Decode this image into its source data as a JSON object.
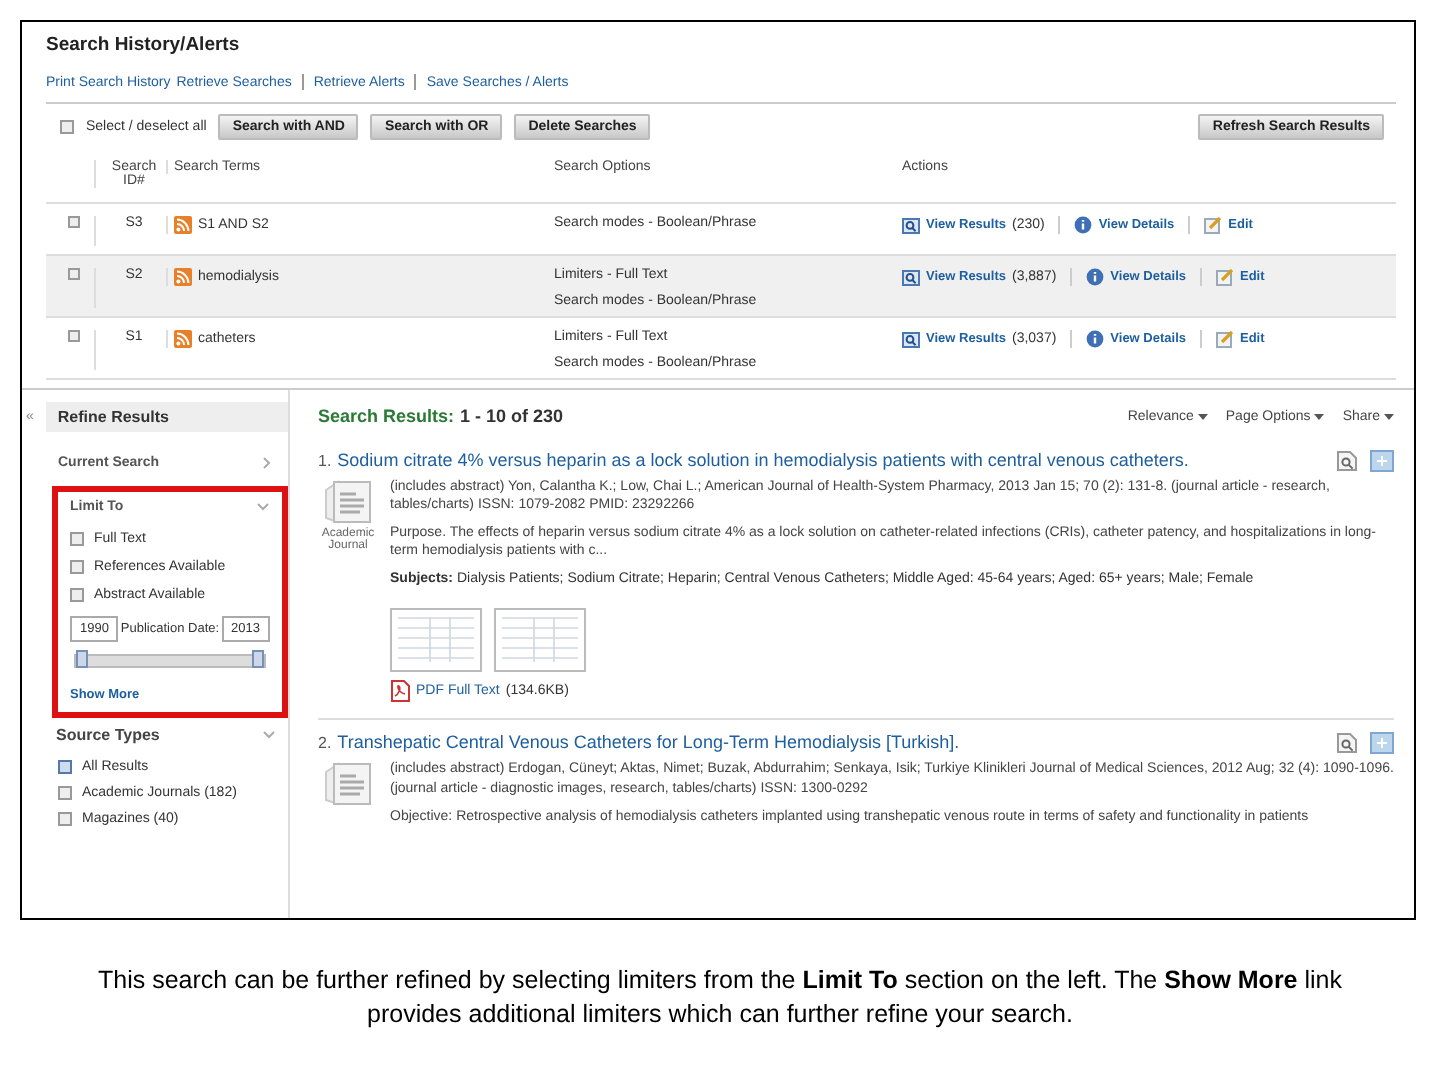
{
  "header": {
    "title": "Search History/Alerts",
    "links": [
      "Print Search History",
      "Retrieve Searches",
      "Retrieve Alerts",
      "Save Searches / Alerts"
    ]
  },
  "history": {
    "select_all": {
      "label": "Select / deselect all",
      "checked": false
    },
    "buttons": [
      "Search with AND",
      "Search with OR",
      "Delete Searches"
    ],
    "refresh_button": "Refresh Search Results",
    "columns": [
      "Search ID#",
      "Search Terms",
      "Search Options",
      "Actions"
    ],
    "rows": [
      {
        "checked": false,
        "id": "S3",
        "terms": "S1 AND S2",
        "options": [
          "Search modes - Boolean/Phrase"
        ],
        "view_results": "View Results",
        "count": "(230)",
        "view_details": "View Details",
        "edit": "Edit"
      },
      {
        "checked": false,
        "id": "S2",
        "terms": "hemodialysis",
        "options": [
          "Limiters - Full Text",
          "Search modes - Boolean/Phrase"
        ],
        "view_results": "View Results",
        "count": "(3,887)",
        "view_details": "View Details",
        "edit": "Edit"
      },
      {
        "checked": false,
        "id": "S1",
        "terms": "catheters",
        "options": [
          "Limiters - Full Text",
          "Search modes - Boolean/Phrase"
        ],
        "view_results": "View Results",
        "count": "(3,037)",
        "view_details": "View Details",
        "edit": "Edit"
      }
    ]
  },
  "sidebar": {
    "collapse": "«",
    "title": "Refine Results",
    "current_search": "Current Search",
    "limit_to": {
      "title": "Limit To",
      "options": [
        {
          "label": "Full Text",
          "checked": false
        },
        {
          "label": "References Available",
          "checked": false
        },
        {
          "label": "Abstract Available",
          "checked": false
        }
      ],
      "date_from": "1990",
      "date_label": "Publication Date:",
      "date_to": "2013",
      "slider": {
        "handles": [
          {
            "level": 0
          },
          {
            "level": 1
          }
        ]
      },
      "show_more": "Show More"
    },
    "source_types": {
      "title": "Source Types",
      "options": [
        {
          "label": "All Results",
          "checked": true
        },
        {
          "label": "Academic Journals (182)",
          "checked": false
        },
        {
          "label": "Magazines (40)",
          "checked": false
        }
      ]
    }
  },
  "results": {
    "heading": "Search Results:",
    "range": "1 - 10 of 230",
    "menus": [
      "Relevance",
      "Page Options",
      "Share"
    ],
    "items": [
      {
        "number": "1.",
        "title": "Sodium citrate 4% versus heparin as a lock solution in hemodialysis patients with central venous catheters.",
        "type_label": "Academic Journal",
        "citation": "(includes abstract) Yon, Calantha K.; Low, Chai L.; American Journal of Health-System Pharmacy, 2013 Jan 15; 70 (2): 131-8. (journal article - research, tables/charts) ISSN: 1079-2082 PMID: 23292266",
        "abstract": "Purpose. The effects of heparin versus sodium citrate 4% as a lock solution on catheter-related infections (CRIs), catheter patency, and hospitalizations in long-term hemodialysis patients with c...",
        "subjects_label": "Subjects:",
        "subjects": "Dialysis Patients; Sodium Citrate; Heparin; Central Venous Catheters; Middle Aged: 45-64 years; Aged: 65+ years; Male; Female",
        "thumbnails": [
          {
            "kind": "table"
          },
          {
            "kind": "table"
          }
        ],
        "pdf_link": "PDF Full Text",
        "pdf_size": "(134.6KB)"
      },
      {
        "number": "2.",
        "title": "Transhepatic Central Venous Catheters for Long-Term Hemodialysis [Turkish].",
        "citation": "(includes abstract) Erdogan, Cüneyt; Aktas, Nimet; Buzak, Abdurrahim; Senkaya, Isik; Turkiye Klinikleri Journal of Medical Sciences, 2012 Aug; 32 (4): 1090-1096. (journal article - diagnostic images, research, tables/charts) ISSN: 1300-0292",
        "abstract": "Objective: Retrospective analysis of hemodialysis catheters implanted using transhepatic venous route in terms of safety and functionality in patients"
      }
    ]
  },
  "caption": "This search can be further refined by selecting limiters from the **Limit To** section on the left. The **Show More** link provides additional limiters which can further refine your search."
}
